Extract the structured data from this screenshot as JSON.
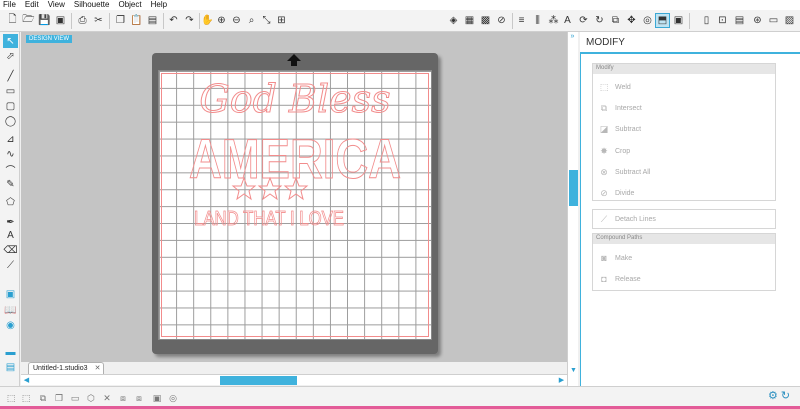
{
  "menu": [
    "File",
    "Edit",
    "View",
    "Silhouette",
    "Object",
    "Help"
  ],
  "canvas": {
    "design_view_label": "DESIGN VIEW",
    "tab_label": "Untitled-1.studio3",
    "artwork": {
      "line1": "God Bless",
      "line2": "AMERICA",
      "line3": "LAND THAT I LOVE"
    }
  },
  "panel": {
    "title": "MODIFY",
    "modify_section": {
      "header": "Modify",
      "items": [
        "Weld",
        "Intersect",
        "Subtract",
        "Crop",
        "Subtract All",
        "Divide"
      ]
    },
    "detach_label": "Detach Lines",
    "compound_section": {
      "header": "Compound Paths",
      "items": [
        "Make",
        "Release"
      ]
    }
  },
  "colors": {
    "accent": "#3fb2dd",
    "cut_line": "#f28c8c",
    "mat": "#666666",
    "bottom_strip": "#e35b98"
  }
}
